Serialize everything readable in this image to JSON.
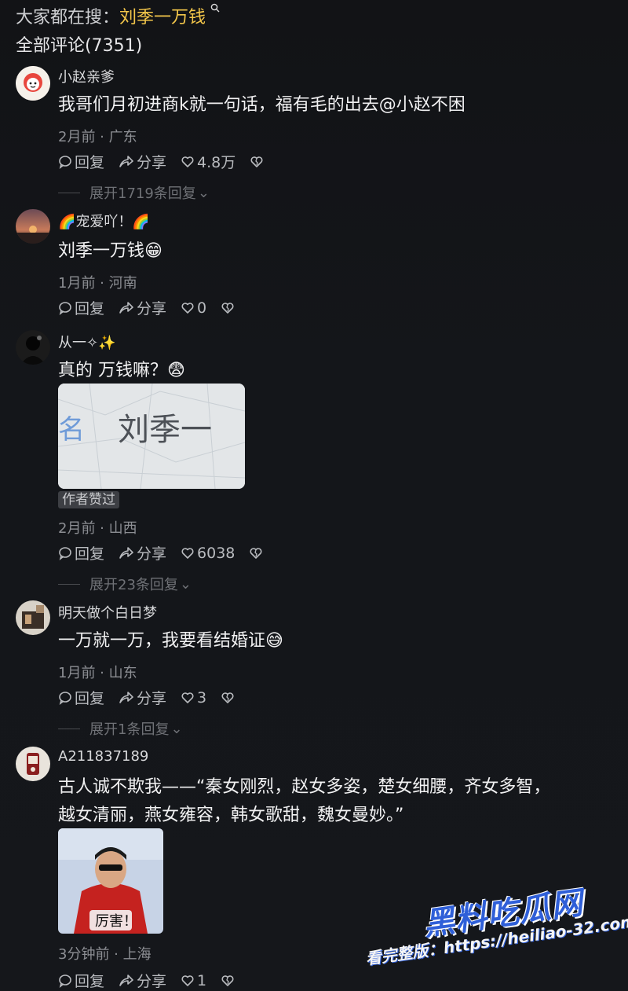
{
  "header": {
    "search_prefix": "大家都在搜：",
    "search_keyword": "刘季一万钱",
    "comments_label": "全部评论(7351)"
  },
  "actions": {
    "reply": "回复",
    "share": "分享"
  },
  "comments": [
    {
      "username": "小赵亲爹",
      "text": "我哥们月初进商k就一句话，福有毛的出去@小赵不困",
      "time_location": "2月前 · 广东",
      "likes": "4.8万",
      "expand": "展开1719条回复"
    },
    {
      "username": "🌈宠爱吖！🌈",
      "text": "刘季一万钱😁",
      "time_location": "1月前 · 河南",
      "likes": "0"
    },
    {
      "username": "从一✧✨",
      "text": "真的 万钱嘛？😨",
      "image_text": "名  刘季一",
      "badge": "作者赞过",
      "time_location": "2月前 · 山西",
      "likes": "6038",
      "expand": "展开23条回复"
    },
    {
      "username": "明天做个白日梦",
      "text": "一万就一万，我要看结婚证😅",
      "time_location": "1月前 · 山东",
      "likes": "3",
      "expand": "展开1条回复"
    },
    {
      "username": "A211837189",
      "text_line1": "古人诚不欺我——“秦女刚烈，赵女多姿，楚女细腰，齐女多智，",
      "text_line2": "越女清丽，燕女雍容，韩女歌甜，魏女曼妙。”",
      "image_caption": "厉害！",
      "time_location": "3分钟前 · 上海",
      "likes": "1"
    }
  ],
  "watermark": {
    "brand": "黑料吃瓜网",
    "url": "看完整版：https://heiliao-32.com"
  }
}
